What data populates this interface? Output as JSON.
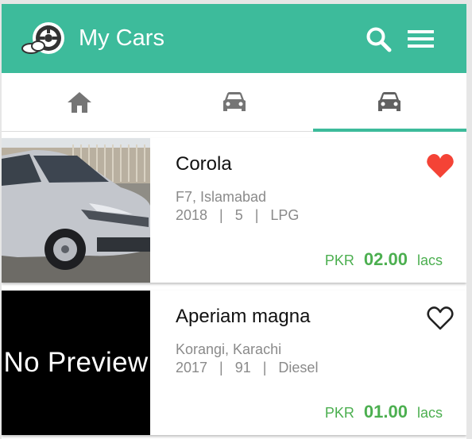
{
  "app": {
    "title": "My Cars",
    "accent_color": "#3dbb9b",
    "price_color": "#4caf50",
    "favorite_color": "#f44336"
  },
  "toolbar": {
    "icons": [
      "search-icon",
      "menu-icon"
    ]
  },
  "tabs": [
    {
      "icon": "home-icon",
      "selected": false
    },
    {
      "icon": "car-icon",
      "selected": false
    },
    {
      "icon": "car-icon",
      "selected": true
    }
  ],
  "listings": [
    {
      "name": "Corola",
      "location": "F7, Islamabad",
      "year": "2018",
      "seats": "5",
      "fuel": "LPG",
      "specs_line": "2018   |   5   |   LPG",
      "currency": "PKR",
      "price": "02.00",
      "unit": "lacs",
      "favorite": true,
      "image": "car-photo"
    },
    {
      "name": "Aperiam magna",
      "location": "Korangi, Karachi",
      "year": "2017",
      "seats": "91",
      "fuel": "Diesel",
      "specs_line": "2017   |   91   |   Diesel",
      "currency": "PKR",
      "price": "01.00",
      "unit": "lacs",
      "favorite": false,
      "image_placeholder": "No Preview"
    }
  ]
}
